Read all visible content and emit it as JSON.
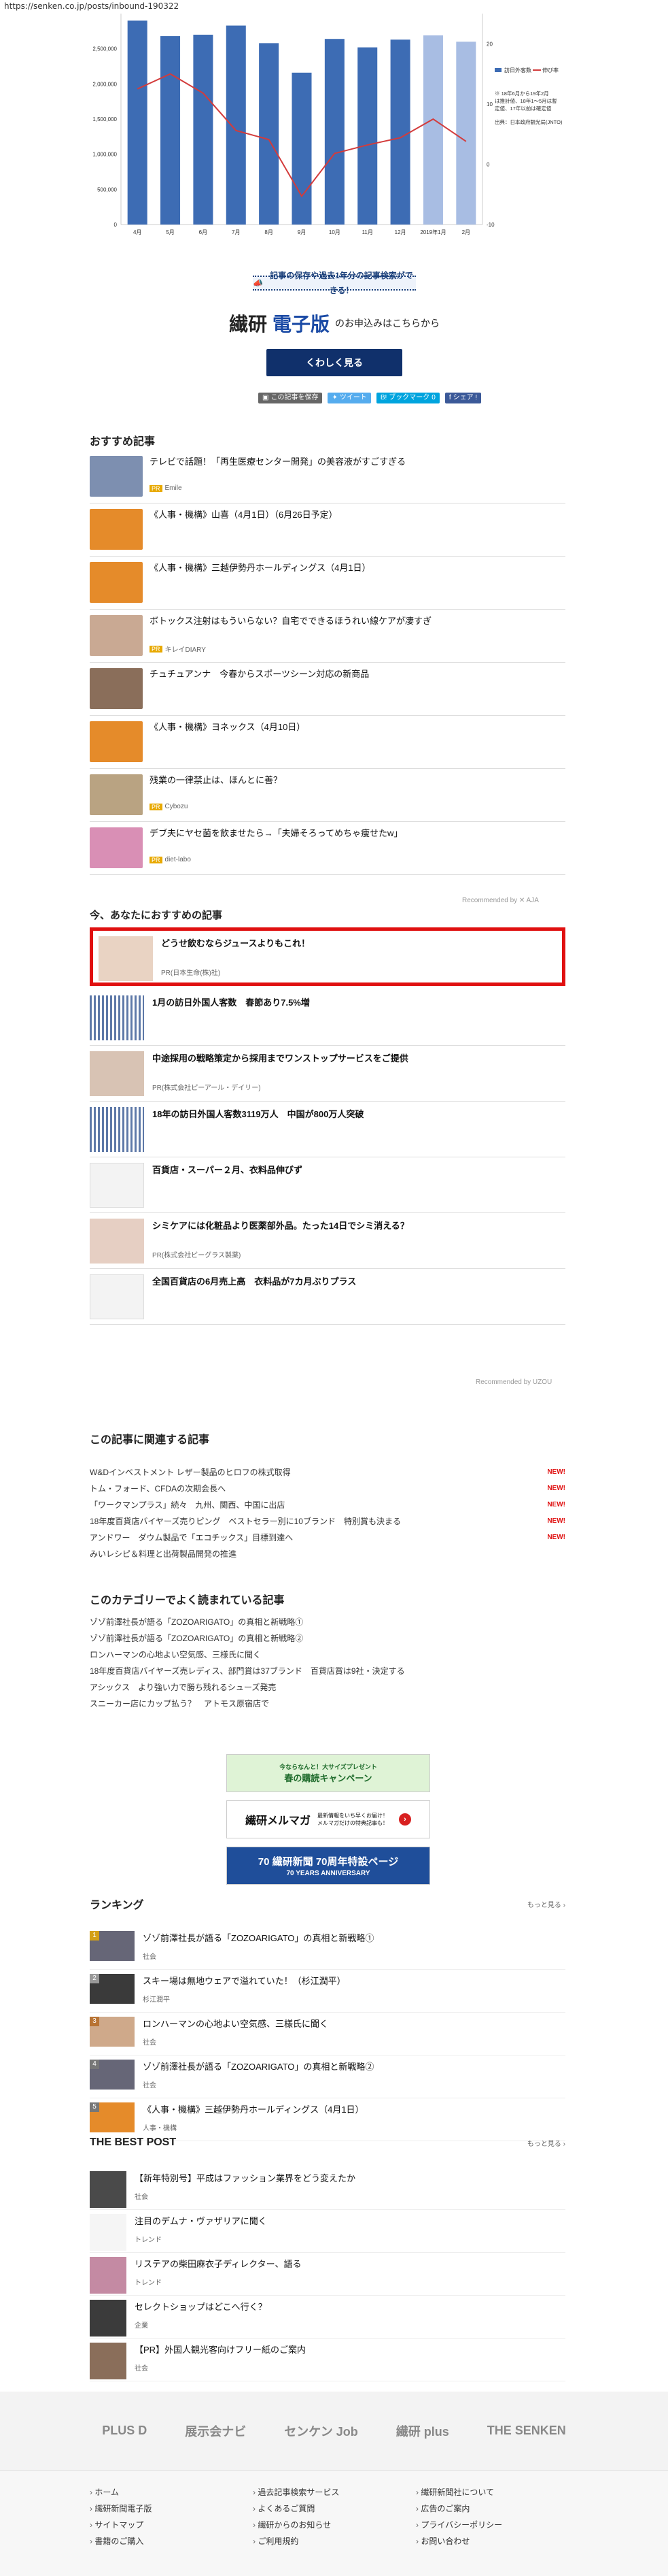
{
  "browser": {
    "url": "https://senken.co.jp/posts/inbound-190322"
  },
  "chart_data": {
    "type": "bar",
    "categories": [
      "4月",
      "5月",
      "6月",
      "7月",
      "8月",
      "9月",
      "10月",
      "11月",
      "12月",
      "2019年1月",
      "2月"
    ],
    "series": [
      {
        "name": "訪日外客数",
        "values": [
          2900000,
          2680000,
          2700000,
          2830000,
          2580000,
          2160000,
          2640000,
          2520000,
          2630000,
          2690000,
          2600000
        ]
      },
      {
        "name": "伸び率",
        "values": [
          12.5,
          15.0,
          11.8,
          5.6,
          4.1,
          -5.3,
          1.8,
          3.2,
          4.4,
          7.5,
          3.8
        ]
      }
    ],
    "y_ticks": [
      "0",
      "500,000",
      "1,000,000",
      "1,500,000",
      "2,000,000",
      "2,500,000"
    ],
    "y2_ticks": [
      "-10",
      "0",
      "10",
      "20"
    ],
    "ylim": [
      0,
      3000000
    ],
    "y2lim": [
      -10,
      25
    ],
    "colors": {
      "bars": "#3d6cb4",
      "bars_light": "#a8bde3",
      "line": "#d33b3b"
    },
    "legend": [
      "訪日外客数",
      "伸び率"
    ],
    "notes": [
      "※ 18年6月から19年2月は推計値、18年1〜5月は暫定値、17年以前は確定値",
      "出典：日本政府観光局(JNTO)"
    ]
  },
  "promo": {
    "banner": "記事の保存や過去1年分の記事検索ができる！",
    "logo_a": "繊研",
    "logo_b": "電子版",
    "logo_sub": "のお申込みはこちらから",
    "button": "くわしく見る"
  },
  "share": {
    "save": "この記事を保存",
    "tweet": "ツイート",
    "hatena": "ブックマーク",
    "hatena_count": "0",
    "facebook": "シェア !"
  },
  "recommend": {
    "title": "おすすめ記事",
    "items": [
      {
        "title": "テレビで話題！「再生医療センター開発」の美容液がすごすぎる",
        "pr": "PR",
        "source": "Emile"
      },
      {
        "title": "《人事・機構》山喜（4月1日）（6月26日予定）",
        "pr": "",
        "source": ""
      },
      {
        "title": "《人事・機構》三越伊勢丹ホールディングス（4月1日）",
        "pr": "",
        "source": ""
      },
      {
        "title": "ボトックス注射はもういらない？自宅でできるほうれい線ケアが凄すぎ",
        "pr": "PR",
        "source": "キレイDIARY"
      },
      {
        "title": "チュチュアンナ　今春からスポーツシーン対応の新商品",
        "pr": "",
        "source": ""
      },
      {
        "title": "《人事・機構》ヨネックス（4月10日）",
        "pr": "",
        "source": ""
      },
      {
        "title": "残業の一律禁止は、ほんとに善？",
        "pr": "PR",
        "source": "Cybozu"
      },
      {
        "title": "デブ夫にヤセ菌を飲ませたら→「夫婦そろってめちゃ痩せたw」",
        "pr": "PR",
        "source": "diet-labo"
      }
    ],
    "recommended_by": "Recommended by ✕ AJA"
  },
  "now": {
    "title": "今、あなたにおすすめの記事",
    "items": [
      {
        "title": "どうせ飲むならジュースよりもこれ！",
        "pr": "PR(日本生命(株)社)"
      },
      {
        "title": "1月の訪日外国人客数　春節あり7.5%増",
        "pr": ""
      },
      {
        "title": "中途採用の戦略策定から採用までワンストップサービスをご提供",
        "pr": "PR(株式会社ピーアール・デイリー)"
      },
      {
        "title": "18年の訪日外国人客数3119万人　中国が800万人突破",
        "pr": ""
      },
      {
        "title": "百貨店・スーパー２月、衣料品伸びず",
        "pr": ""
      },
      {
        "title": "シミケアには化粧品より医薬部外品。たった14日でシミ消える？",
        "pr": "PR(株式会社ビーグラス製薬)"
      },
      {
        "title": "全国百貨店の6月売上高　衣料品が7カ月ぶりプラス",
        "pr": ""
      }
    ],
    "recommended_by": "Recommended by UZOU"
  },
  "related": {
    "title": "この記事に関連する記事",
    "items": [
      {
        "text": "W&Dインベストメント レザー製品のヒロフの株式取得",
        "new": "NEW!"
      },
      {
        "text": "トム・フォード、CFDAの次期会長へ",
        "new": "NEW!"
      },
      {
        "text": "「ワークマンプラス」続々　九州、関西、中国に出店",
        "new": "NEW!"
      },
      {
        "text": "18年度百貨店バイヤーズ売りピング　ベストセラー別に10ブランド　特別賞も決まる",
        "new": "NEW!"
      },
      {
        "text": "アンドワー　ダウム製品で「エコチックス」目標到達へ",
        "new": "NEW!"
      },
      {
        "text": "みいレシピ＆料理と出荷製品開発の推進",
        "new": ""
      }
    ]
  },
  "category": {
    "title": "このカテゴリーでよく読まれている記事",
    "items": [
      "ゾゾ前澤社長が語る「ZOZOARIGATO」の真相と新戦略①",
      "ゾゾ前澤社長が語る「ZOZOARIGATO」の真相と新戦略②",
      "ロンハーマンの心地よい空気感、三様氏に聞く",
      "18年度百貨店バイヤーズ売レディス、部門賞は37ブランド　百貨店賞は9社・決定する",
      "アシックス　より強い力で勝ち残れるシューズ発売",
      "スニーカー店にカップ払う？　アトモス原宿店で"
    ]
  },
  "banners": {
    "spring_top": "今ならなんと！大サイズプレゼント",
    "spring": "春の購読キャンペーン",
    "mail": "繊研メルマガ",
    "mail_sub": "最新情報をいち早くお届け！メルマガだけの特典記事も！",
    "anniv_a": "70 繊研新聞 70周年特設ページ",
    "anniv_b": "70 YEARS ANNIVERSARY"
  },
  "ranking": {
    "title": "ランキング",
    "more": "もっと見る ›",
    "items": [
      {
        "rank": "1",
        "title": "ゾゾ前澤社長が語る「ZOZOARIGATO」の真相と新戦略①",
        "cat": "社会"
      },
      {
        "rank": "2",
        "title": "スキー場は無地ウェアで溢れていた！（杉江潤平）",
        "cat": "杉江潤平"
      },
      {
        "rank": "3",
        "title": "ロンハーマンの心地よい空気感、三様氏に聞く",
        "cat": "社会"
      },
      {
        "rank": "4",
        "title": "ゾゾ前澤社長が語る「ZOZOARIGATO」の真相と新戦略②",
        "cat": "社会"
      },
      {
        "rank": "5",
        "title": "《人事・機構》三越伊勢丹ホールディングス（4月1日）",
        "cat": "人事・機構"
      }
    ]
  },
  "best": {
    "title": "THE BEST POST",
    "more": "もっと見る ›",
    "items": [
      {
        "title": "【新年特別号】平成はファッション業界をどう変えたか",
        "cat": "社会"
      },
      {
        "title": "注目のデムナ・ヴァザリアに聞く",
        "cat": "トレンド"
      },
      {
        "title": "リステアの柴田麻衣子ディレクター、語る",
        "cat": "トレンド"
      },
      {
        "title": "セレクトショップはどこへ行く？",
        "cat": "企業"
      },
      {
        "title": "【PR】外国人観光客向けフリー紙のご案内",
        "cat": "社会"
      }
    ]
  },
  "footer": {
    "logos": [
      "PLUS D",
      "展示会ナビ",
      "センケン Job",
      "繊研 plus",
      "THE SENKEN"
    ],
    "col1": [
      "ホーム",
      "繊研新聞電子版",
      "サイトマップ",
      "書籍のご購入"
    ],
    "col2": [
      "過去記事検索サービス",
      "よくあるご質問",
      "繊研からのお知らせ",
      "ご利用規約"
    ],
    "col3": [
      "繊研新聞社について",
      "広告のご案内",
      "プライバシーポリシー",
      "お問い合わせ"
    ]
  }
}
